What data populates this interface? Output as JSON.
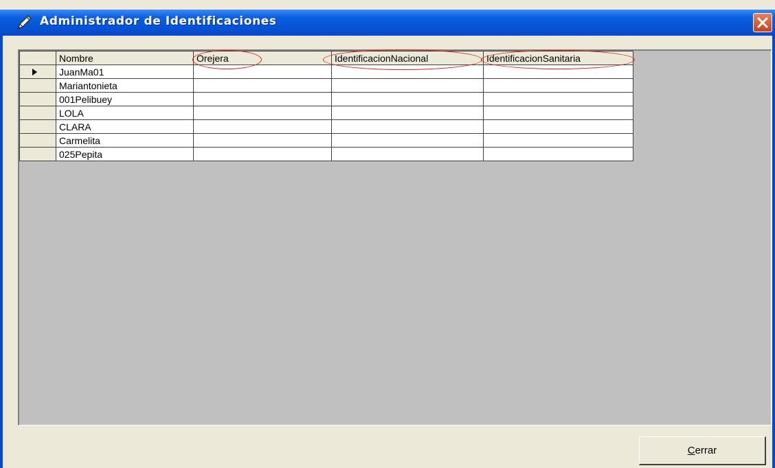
{
  "window": {
    "title": "Administrador de Identificaciones",
    "close_glyph": "✕"
  },
  "grid": {
    "columns": [
      "Nombre",
      "Orejera",
      "IdentificacionNacional",
      "IdentificacionSanitaria"
    ],
    "rows": [
      {
        "nombre": "JuanMa01",
        "orejera": "",
        "nacional": "",
        "sanitaria": ""
      },
      {
        "nombre": "Mariantonieta",
        "orejera": "",
        "nacional": "",
        "sanitaria": ""
      },
      {
        "nombre": "001Pelibuey",
        "orejera": "",
        "nacional": "",
        "sanitaria": ""
      },
      {
        "nombre": "LOLA",
        "orejera": "",
        "nacional": "",
        "sanitaria": ""
      },
      {
        "nombre": "CLARA",
        "orejera": "",
        "nacional": "",
        "sanitaria": ""
      },
      {
        "nombre": "Carmelita",
        "orejera": "",
        "nacional": "",
        "sanitaria": ""
      },
      {
        "nombre": "025Pepita",
        "orejera": "",
        "nacional": "",
        "sanitaria": ""
      }
    ],
    "selected_row": 0
  },
  "buttons": {
    "close_mnemonic": "C",
    "close_rest": "errar"
  },
  "colors": {
    "title_bar": "#0553d6",
    "highlight_ring": "#e0201a",
    "grid_background": "#c0c0c0"
  },
  "icons": {
    "title": "pencil-icon",
    "close": "close-icon",
    "row_indicator": "triangle-right-icon"
  }
}
